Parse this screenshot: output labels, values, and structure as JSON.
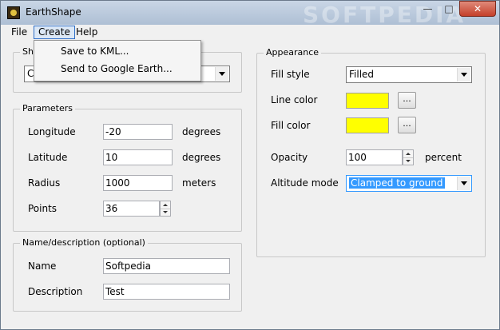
{
  "window": {
    "title": "EarthShape",
    "watermark": "SOFTPEDIA"
  },
  "menu": {
    "file": "File",
    "create": "Create",
    "help": "Help",
    "create_items": [
      "Save to KML...",
      "Send to Google Earth..."
    ]
  },
  "shape_group": {
    "title_partial": "Sh",
    "value_partial": "C"
  },
  "parameters": {
    "title": "Parameters",
    "longitude": {
      "label": "Longitude",
      "value": "-20",
      "unit": "degrees"
    },
    "latitude": {
      "label": "Latitude",
      "value": "10",
      "unit": "degrees"
    },
    "radius": {
      "label": "Radius",
      "value": "1000",
      "unit": "meters"
    },
    "points": {
      "label": "Points",
      "value": "36"
    }
  },
  "namedesc": {
    "title": "Name/description (optional)",
    "name": {
      "label": "Name",
      "value": "Softpedia"
    },
    "description": {
      "label": "Description",
      "value": "Test"
    }
  },
  "appearance": {
    "title": "Appearance",
    "fill_style": {
      "label": "Fill style",
      "value": "Filled"
    },
    "line_color": {
      "label": "Line color",
      "color": "#ffff00",
      "button": "..."
    },
    "fill_color": {
      "label": "Fill color",
      "color": "#ffff00",
      "button": "..."
    },
    "opacity": {
      "label": "Opacity",
      "value": "100",
      "unit": "percent"
    },
    "altitude_mode": {
      "label": "Altitude mode",
      "value": "Clamped to ground"
    }
  },
  "colors": {
    "accent": "#3399ff",
    "menu_highlight": "#dce8f6"
  }
}
